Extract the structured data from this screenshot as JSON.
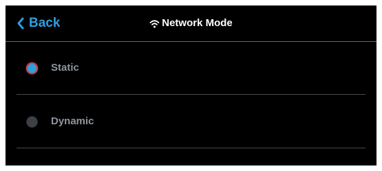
{
  "header": {
    "back_label": "Back",
    "title": "Network Mode",
    "title_icon": "wifi-icon",
    "back_icon": "chevron-left-icon"
  },
  "options": [
    {
      "label": "Static",
      "selected": true
    },
    {
      "label": "Dynamic",
      "selected": false
    }
  ],
  "colors": {
    "accent": "#2f9ee0",
    "background": "#000000",
    "title": "#ffffff",
    "option_text": "#8e959c",
    "radio_unselected": "#3d4146",
    "radio_selected_ring": "#c24a4a"
  }
}
